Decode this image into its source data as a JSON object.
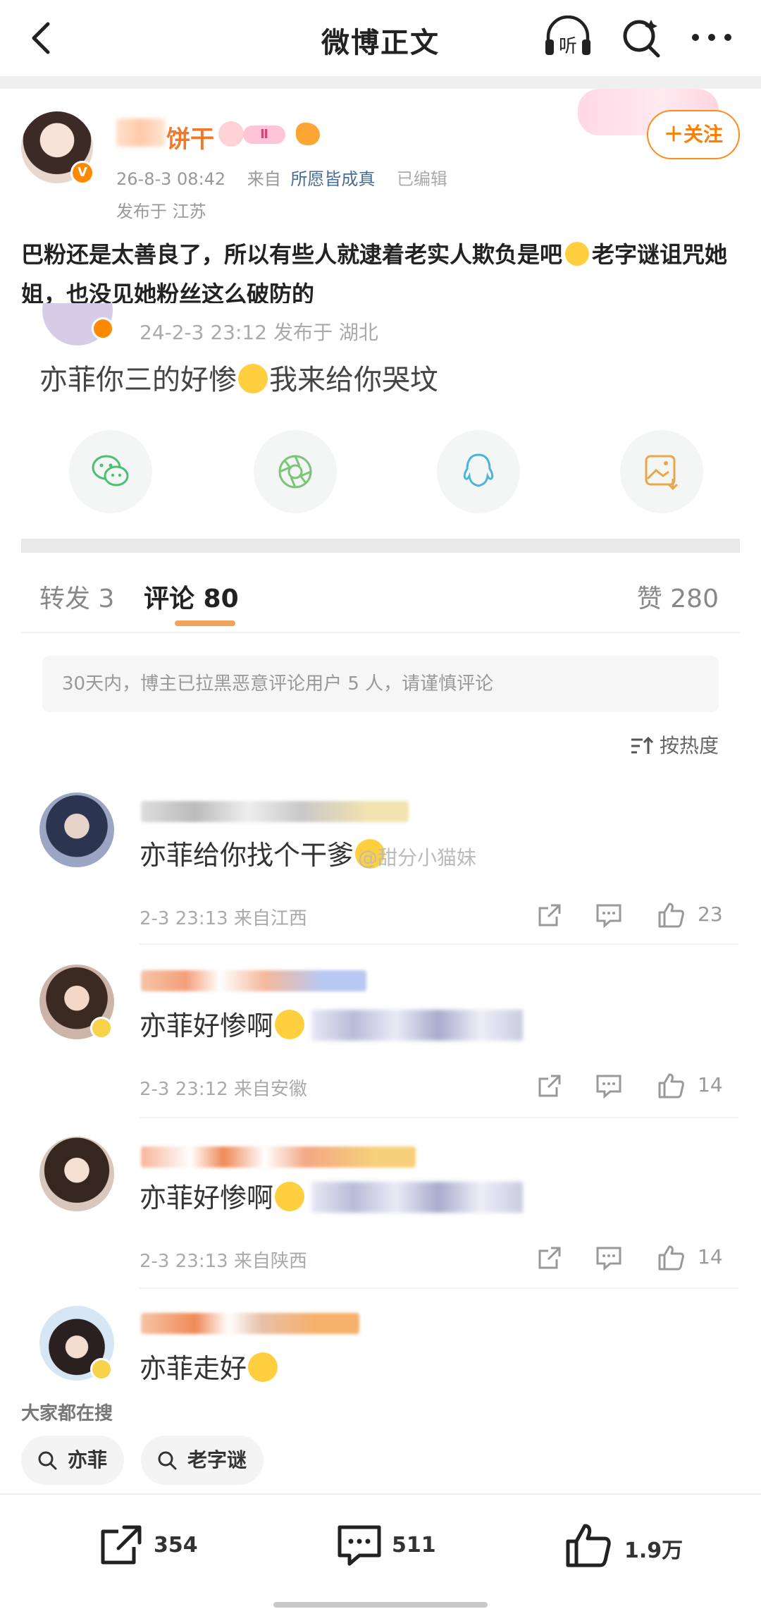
{
  "header": {
    "title": "微博正文",
    "listen_label": "听"
  },
  "author": {
    "name": "饼干",
    "level_badge": "Ⅱ",
    "v_badge": "V",
    "time": "26-8-3 08:42",
    "from_label": "来自",
    "source": "所愿皆成真",
    "edited": "已编辑",
    "location": "发布于  江苏",
    "follow_label": "＋关注"
  },
  "post": {
    "text_part1": "巴粉还是太善良了，所以有些人就逮着老实人欺负是吧",
    "text_part2": "老字谜诅咒她姐，也没见她粉丝这么破防的",
    "embed": {
      "meta": "24-2-3 23:12  发布于 湖北",
      "text_before": "亦菲你三的好惨",
      "text_after": "我来给你哭坟"
    },
    "share_icons": [
      "wechat-icon",
      "moments-icon",
      "qq-icon",
      "save-image-icon"
    ]
  },
  "tabs": {
    "repost": "转发 3",
    "comments": "评论 80",
    "likes": "赞 280"
  },
  "notice": "30天内，博主已拉黑恶意评论用户 5 人，请谨慎评论",
  "sort_label": "按热度",
  "comments": [
    {
      "text": "亦菲给你找个干爹",
      "watermark": "@甜分小猫妹",
      "time": "2-3 23:13 来自江西",
      "likes": "23"
    },
    {
      "text": "亦菲好惨啊",
      "time": "2-3 23:12 来自安徽",
      "likes": "14"
    },
    {
      "text": "亦菲好惨啊",
      "time": "2-3 23:13 来自陕西",
      "likes": "14"
    },
    {
      "text": "亦菲走好"
    }
  ],
  "trending": {
    "title": "大家都在搜",
    "items": [
      "亦菲",
      "老字谜"
    ]
  },
  "bottom_bar": {
    "repost_count": "354",
    "comment_count": "511",
    "like_count": "1.9万"
  },
  "colors": {
    "accent_orange": "#ff7d00",
    "link_blue": "#496b98"
  }
}
